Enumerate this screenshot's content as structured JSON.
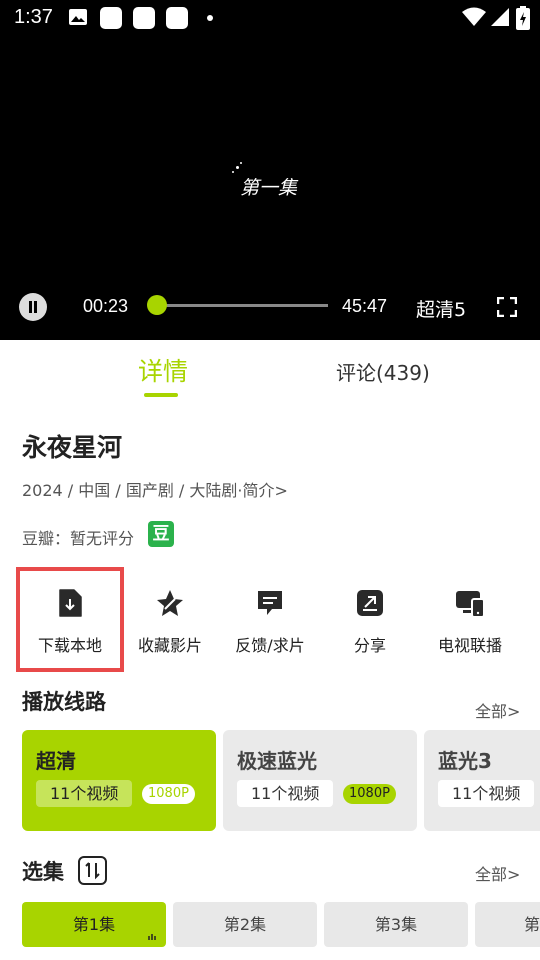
{
  "status_bar": {
    "time": "1:37"
  },
  "player": {
    "episode_label": "第一集",
    "current_time": "00:23",
    "total_time": "45:47",
    "quality": "超清5",
    "progress": 0.0084
  },
  "tabs": [
    {
      "label": "详情",
      "active": true
    },
    {
      "label": "评论(439)",
      "active": false
    }
  ],
  "detail": {
    "title": "永夜星河",
    "meta": "2024 / 中国 / 国产剧 / 大陆剧·简介>",
    "douban_text": "豆瓣：暂无评分",
    "douban_badge": "豆"
  },
  "actions": [
    {
      "label": "下载本地",
      "icon": "download-file-icon"
    },
    {
      "label": "收藏影片",
      "icon": "star-icon"
    },
    {
      "label": "反馈/求片",
      "icon": "feedback-icon"
    },
    {
      "label": "分享",
      "icon": "share-icon"
    },
    {
      "label": "电视联播",
      "icon": "tv-cast-icon"
    }
  ],
  "routes_section": {
    "title": "播放线路",
    "more": "全部>",
    "routes": [
      {
        "name": "超清",
        "count": "11个视频",
        "res": "1080P",
        "active": true
      },
      {
        "name": "极速蓝光",
        "count": "11个视频",
        "res": "1080P",
        "active": false
      },
      {
        "name": "蓝光3",
        "count": "11个视频",
        "res": "",
        "active": false
      }
    ]
  },
  "episodes_section": {
    "title": "选集",
    "more": "全部>",
    "episodes": [
      {
        "label": "第1集",
        "active": true
      },
      {
        "label": "第2集",
        "active": false
      },
      {
        "label": "第3集",
        "active": false
      },
      {
        "label": "第",
        "active": false
      }
    ]
  },
  "colors": {
    "accent": "#a8d400",
    "highlight": "#e84a4a",
    "douban": "#2bb24c"
  }
}
